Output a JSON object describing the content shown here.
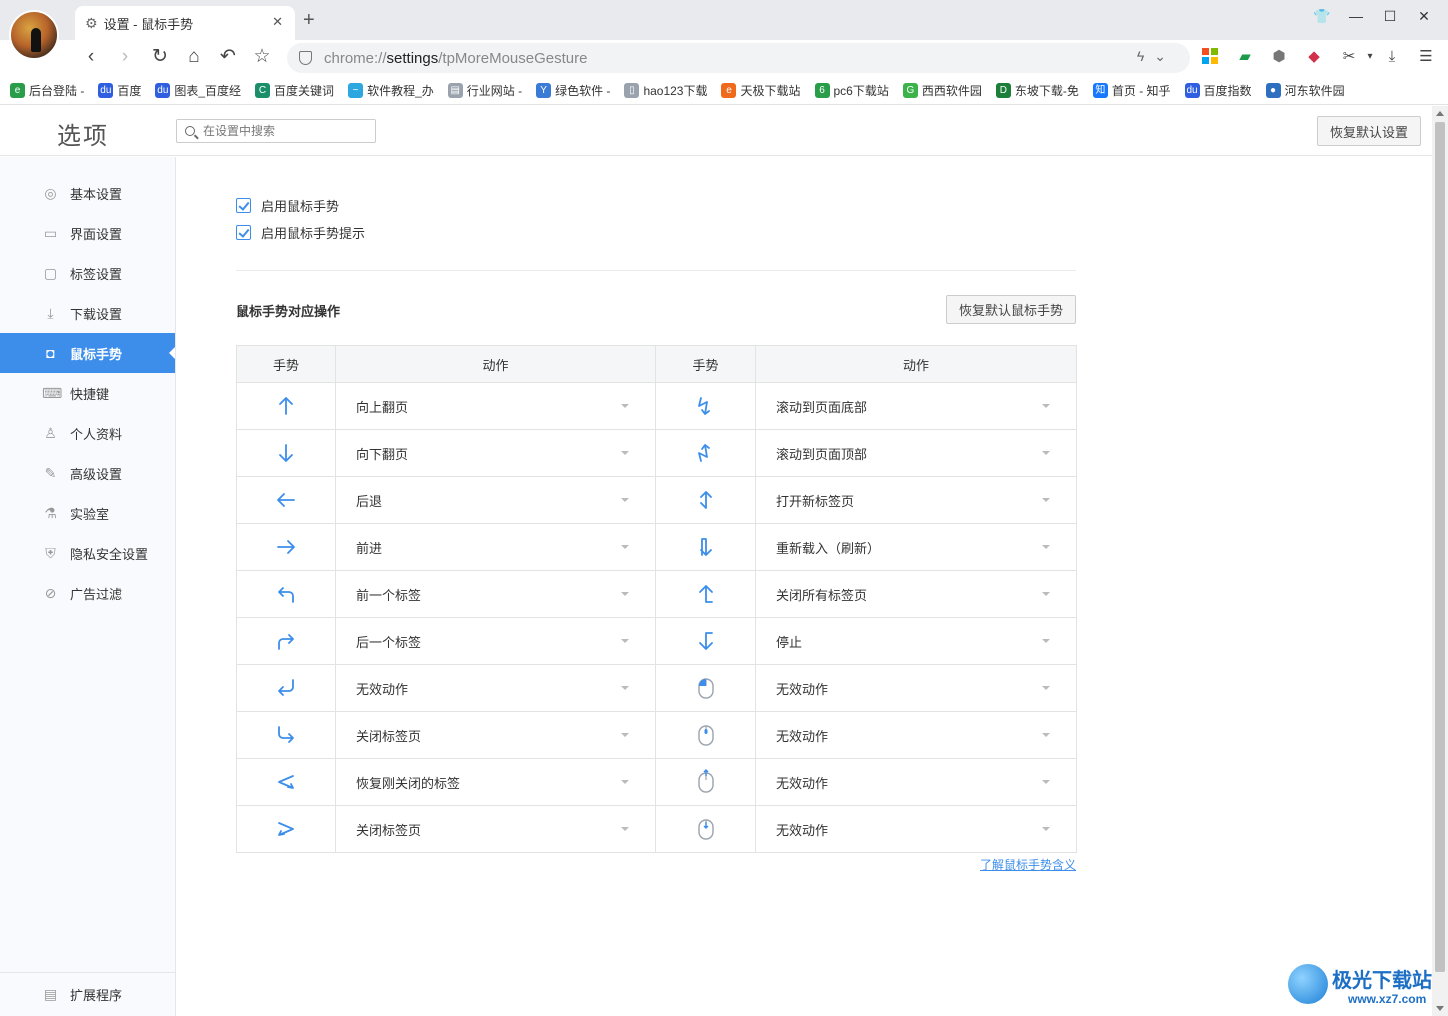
{
  "browser": {
    "tab_title": "设置 - 鼠标手势",
    "tab_close": "✕",
    "new_tab": "+",
    "url_prefix": "chrome://",
    "url_host": "settings",
    "url_path": "/tpMoreMouseGesture",
    "bookmarks": [
      {
        "label": "后台登陆 -",
        "color": "#2a9d4a",
        "glyph": "e"
      },
      {
        "label": "百度",
        "color": "#2f5fe0",
        "glyph": "du"
      },
      {
        "label": "图表_百度经",
        "color": "#2f5fe0",
        "glyph": "du"
      },
      {
        "label": "百度关键词",
        "color": "#1b8f6a",
        "glyph": "C"
      },
      {
        "label": "软件教程_办",
        "color": "#2da7e0",
        "glyph": "~"
      },
      {
        "label": "行业网站 -",
        "color": "#9aa3ad",
        "glyph": "▤"
      },
      {
        "label": "绿色软件 -",
        "color": "#3a7bd5",
        "glyph": "Y"
      },
      {
        "label": "hao123下载",
        "color": "#9aa3ad",
        "glyph": "▯"
      },
      {
        "label": "天极下载站",
        "color": "#f06a1e",
        "glyph": "e"
      },
      {
        "label": "pc6下载站",
        "color": "#2a9d4a",
        "glyph": "6"
      },
      {
        "label": "西西软件园",
        "color": "#3bb34a",
        "glyph": "G"
      },
      {
        "label": "东坡下载-免",
        "color": "#1b7f3a",
        "glyph": "D"
      },
      {
        "label": "首页 - 知乎",
        "color": "#1777ff",
        "glyph": "知"
      },
      {
        "label": "百度指数",
        "color": "#2f5fe0",
        "glyph": "du"
      },
      {
        "label": "河东软件园",
        "color": "#2f6fc0",
        "glyph": "●"
      }
    ]
  },
  "header": {
    "title": "选项",
    "search_placeholder": "在设置中搜索",
    "restore_all_label": "恢复默认设置"
  },
  "sidebar": {
    "items": [
      {
        "label": "基本设置",
        "icon": "settings-circle-icon",
        "glyph": "◎",
        "active": false
      },
      {
        "label": "界面设置",
        "icon": "window-icon",
        "glyph": "▭",
        "active": false
      },
      {
        "label": "标签设置",
        "icon": "tab-icon",
        "glyph": "▢",
        "active": false
      },
      {
        "label": "下载设置",
        "icon": "download-icon",
        "glyph": "⤓",
        "active": false
      },
      {
        "label": "鼠标手势",
        "icon": "mouse-icon",
        "glyph": "◘",
        "active": true
      },
      {
        "label": "快捷键",
        "icon": "keyboard-icon",
        "glyph": "⌨",
        "active": false
      },
      {
        "label": "个人资料",
        "icon": "user-icon",
        "glyph": "♙",
        "active": false
      },
      {
        "label": "高级设置",
        "icon": "wrench-icon",
        "glyph": "✎",
        "active": false
      },
      {
        "label": "实验室",
        "icon": "flask-icon",
        "glyph": "⚗",
        "active": false
      },
      {
        "label": "隐私安全设置",
        "icon": "shield-plus-icon",
        "glyph": "⛨",
        "active": false
      },
      {
        "label": "广告过滤",
        "icon": "block-icon",
        "glyph": "⊘",
        "active": false
      }
    ],
    "extensions_label": "扩展程序"
  },
  "main": {
    "checkbox_enable": "启用鼠标手势",
    "checkbox_hint": "启用鼠标手势提示",
    "section_title": "鼠标手势对应操作",
    "restore_gesture_label": "恢复默认鼠标手势",
    "col_gesture": "手势",
    "col_action": "动作",
    "learn_link": "了解鼠标手势含义",
    "rows": [
      {
        "left_icon": "arrow-up-icon",
        "left_action": "向上翻页",
        "right_icon": "zigzag-down-icon",
        "right_action": "滚动到页面底部"
      },
      {
        "left_icon": "arrow-down-icon",
        "left_action": "向下翻页",
        "right_icon": "zigzag-up-icon",
        "right_action": "滚动到页面顶部"
      },
      {
        "left_icon": "arrow-left-icon",
        "left_action": "后退",
        "right_icon": "down-up-icon",
        "right_action": "打开新标签页"
      },
      {
        "left_icon": "arrow-right-icon",
        "left_action": "前进",
        "right_icon": "up-down-icon",
        "right_action": "重新载入（刷新）"
      },
      {
        "left_icon": "up-left-icon",
        "left_action": "前一个标签",
        "right_icon": "right-up-icon",
        "right_action": "关闭所有标签页"
      },
      {
        "left_icon": "up-right-icon",
        "left_action": "后一个标签",
        "right_icon": "right-down-icon",
        "right_action": "停止"
      },
      {
        "left_icon": "down-left-icon",
        "left_action": "无效动作",
        "right_icon": "mouse-left-click-icon",
        "right_action": "无效动作"
      },
      {
        "left_icon": "down-right-icon",
        "left_action": "关闭标签页",
        "right_icon": "mouse-middle-click-icon",
        "right_action": "无效动作"
      },
      {
        "left_icon": "left-right-icon",
        "left_action": "恢复刚关闭的标签",
        "right_icon": "mouse-wheel-up-icon",
        "right_action": "无效动作"
      },
      {
        "left_icon": "right-left-icon",
        "left_action": "关闭标签页",
        "right_icon": "mouse-wheel-down-icon",
        "right_action": "无效动作"
      }
    ]
  },
  "watermark": {
    "text": "极光下载站",
    "url": "www.xz7.com"
  },
  "colors": {
    "accent": "#3c8eea",
    "icon_blue": "#3c8eea"
  }
}
